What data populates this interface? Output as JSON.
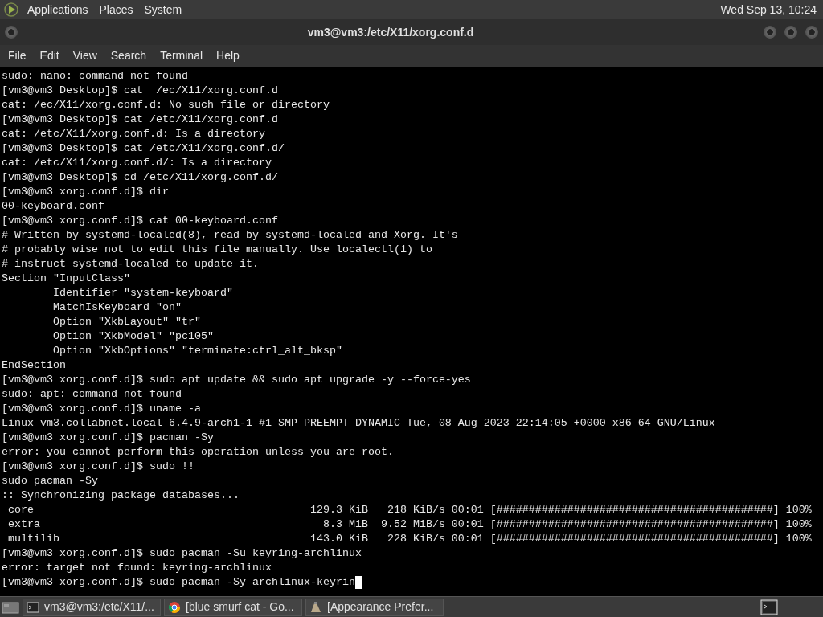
{
  "top_panel": {
    "menus": [
      "Applications",
      "Places",
      "System"
    ],
    "clock": "Wed Sep 13, 10:24"
  },
  "window": {
    "title": "vm3@vm3:/etc/X11/xorg.conf.d"
  },
  "menu_bar": [
    "File",
    "Edit",
    "View",
    "Search",
    "Terminal",
    "Help"
  ],
  "terminal": {
    "lines": [
      "sudo: nano: command not found",
      "[vm3@vm3 Desktop]$ cat  /ec/X11/xorg.conf.d",
      "cat: /ec/X11/xorg.conf.d: No such file or directory",
      "[vm3@vm3 Desktop]$ cat /etc/X11/xorg.conf.d",
      "cat: /etc/X11/xorg.conf.d: Is a directory",
      "[vm3@vm3 Desktop]$ cat /etc/X11/xorg.conf.d/",
      "cat: /etc/X11/xorg.conf.d/: Is a directory",
      "[vm3@vm3 Desktop]$ cd /etc/X11/xorg.conf.d/",
      "[vm3@vm3 xorg.conf.d]$ dir",
      "00-keyboard.conf",
      "[vm3@vm3 xorg.conf.d]$ cat 00-keyboard.conf",
      "# Written by systemd-localed(8), read by systemd-localed and Xorg. It's",
      "# probably wise not to edit this file manually. Use localectl(1) to",
      "# instruct systemd-localed to update it.",
      "Section \"InputClass\"",
      "        Identifier \"system-keyboard\"",
      "        MatchIsKeyboard \"on\"",
      "        Option \"XkbLayout\" \"tr\"",
      "        Option \"XkbModel\" \"pc105\"",
      "        Option \"XkbOptions\" \"terminate:ctrl_alt_bksp\"",
      "EndSection",
      "[vm3@vm3 xorg.conf.d]$ sudo apt update && sudo apt upgrade -y --force-yes",
      "sudo: apt: command not found",
      "[vm3@vm3 xorg.conf.d]$ uname -a",
      "Linux vm3.collabnet.local 6.4.9-arch1-1 #1 SMP PREEMPT_DYNAMIC Tue, 08 Aug 2023 22:14:05 +0000 x86_64 GNU/Linux",
      "[vm3@vm3 xorg.conf.d]$ pacman -Sy",
      "error: you cannot perform this operation unless you are root.",
      "[vm3@vm3 xorg.conf.d]$ sudo !!",
      "sudo pacman -Sy",
      ":: Synchronizing package databases...",
      " core                                           129.3 KiB   218 KiB/s 00:01 [###########################################] 100%",
      " extra                                            8.3 MiB  9.52 MiB/s 00:01 [###########################################] 100%",
      " multilib                                       143.0 KiB   228 KiB/s 00:01 [###########################################] 100%",
      "[vm3@vm3 xorg.conf.d]$ sudo pacman -Su keyring-archlinux",
      "error: target not found: keyring-archlinux",
      "[vm3@vm3 xorg.conf.d]$ sudo pacman -Sy archlinux-keyrin"
    ]
  },
  "taskbar": {
    "items": [
      {
        "kind": "terminal",
        "label": "vm3@vm3:/etc/X11/..."
      },
      {
        "kind": "browser",
        "label": "[blue smurf cat - Go..."
      },
      {
        "kind": "settings",
        "label": "[Appearance Prefer..."
      }
    ]
  }
}
